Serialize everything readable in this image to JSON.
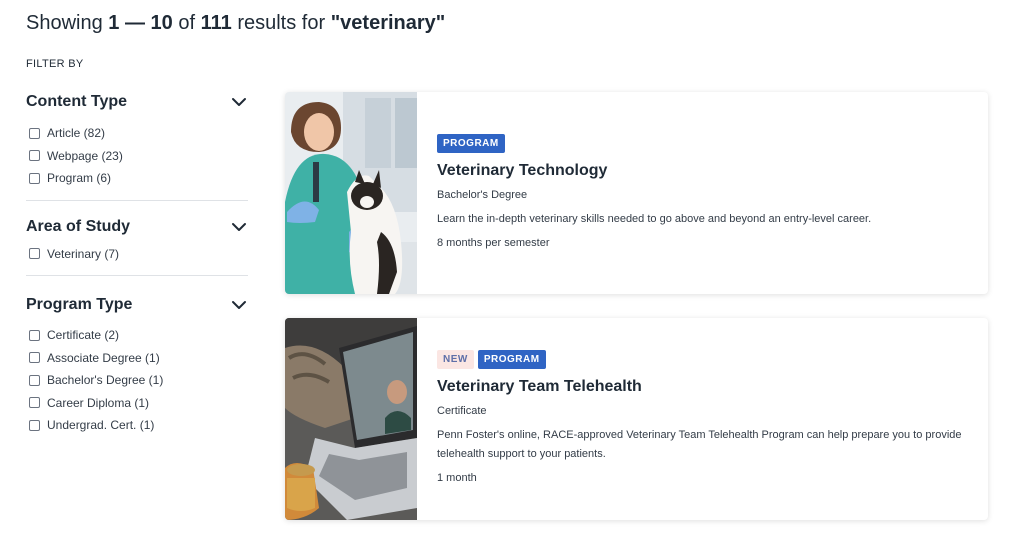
{
  "results_summary": {
    "prefix": "Showing",
    "range_start": "1",
    "range_sep": "—",
    "range_end": "10",
    "of": "of",
    "total": "111",
    "results_for": "results for",
    "query": "\"veterinary\""
  },
  "filter_by_label": "FILTER BY",
  "filters": [
    {
      "title": "Content Type",
      "items": [
        "Article (82)",
        "Webpage (23)",
        "Program (6)"
      ]
    },
    {
      "title": "Area of Study",
      "items": [
        "Veterinary (7)"
      ]
    },
    {
      "title": "Program Type",
      "items": [
        "Certificate (2)",
        "Associate Degree (1)",
        "Bachelor's Degree (1)",
        "Career Diploma (1)",
        "Undergrad. Cert. (1)"
      ]
    }
  ],
  "results": [
    {
      "badges": [
        "PROGRAM"
      ],
      "title": "Veterinary Technology",
      "subtitle": "Bachelor's Degree",
      "description": "Learn the in-depth veterinary skills needed to go above and beyond an entry-level career.",
      "duration": "8 months per semester",
      "image": "vet-examining-cat-photo"
    },
    {
      "badges": [
        "NEW",
        "PROGRAM"
      ],
      "title": "Veterinary Team Telehealth",
      "subtitle": "Certificate",
      "description": "Penn Foster's online, RACE-approved Veterinary Team Telehealth Program can help prepare you to provide telehealth support to your patients.",
      "duration": "1 month",
      "image": "laptop-telehealth-cat-photo"
    }
  ],
  "colors": {
    "badge_program": "#2f64c4",
    "badge_new_bg": "#fbe6e3",
    "badge_new_text": "#5e6fa8"
  }
}
